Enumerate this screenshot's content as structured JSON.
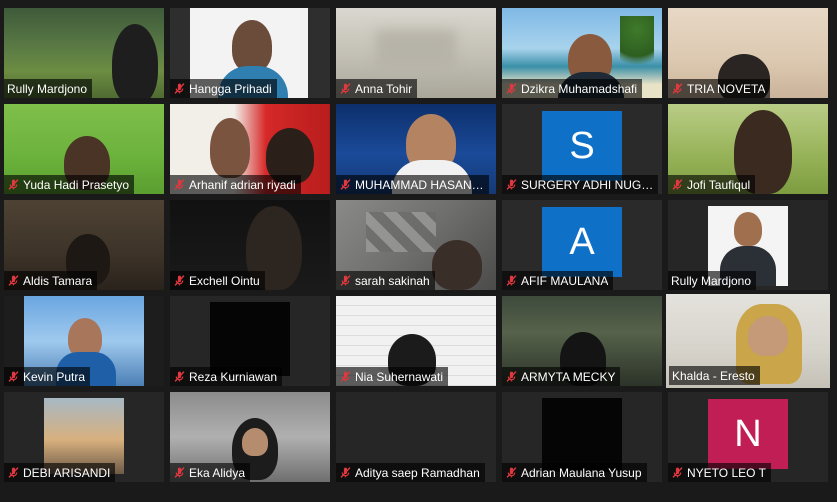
{
  "participants": [
    {
      "name": "Rully Mardjono",
      "muted": false
    },
    {
      "name": "Hangga Prihadi",
      "muted": true
    },
    {
      "name": "Anna Tohir",
      "muted": true
    },
    {
      "name": "Dzikra Muhamadshafi",
      "muted": true
    },
    {
      "name": "TRIA NOVETA",
      "muted": true
    },
    {
      "name": "Yuda Hadi Prasetyo",
      "muted": true
    },
    {
      "name": "Arhanif adrian riyadi",
      "muted": true
    },
    {
      "name": "MUHAMMAD HASAN…",
      "muted": true
    },
    {
      "name": "SURGERY ADHI NUG…",
      "muted": true,
      "avatar_letter": "S"
    },
    {
      "name": "Jofi Taufiqul",
      "muted": true
    },
    {
      "name": "Aldis Tamara",
      "muted": true
    },
    {
      "name": "Exchell Ointu",
      "muted": true
    },
    {
      "name": "sarah sakinah",
      "muted": true
    },
    {
      "name": "AFIF MAULANA",
      "muted": true,
      "avatar_letter": "A"
    },
    {
      "name": "Rully Mardjono",
      "muted": false
    },
    {
      "name": "Kevin Putra",
      "muted": true
    },
    {
      "name": "Reza Kurniawan",
      "muted": true
    },
    {
      "name": "Nia Suhernawati",
      "muted": true
    },
    {
      "name": "ARMYTA MECKY",
      "muted": true
    },
    {
      "name": "Khalda - Eresto",
      "muted": false,
      "active_speaker": true
    },
    {
      "name": "DEBI ARISANDI",
      "muted": true
    },
    {
      "name": "Eka Alidya",
      "muted": true
    },
    {
      "name": "Aditya saep Ramadhan",
      "muted": true
    },
    {
      "name": "Adrian Maulana Yusup",
      "muted": true
    },
    {
      "name": "NYETO LEO T",
      "muted": true,
      "avatar_letter": "N"
    }
  ],
  "colors": {
    "background": "#1a1a1a",
    "active_speaker_border": "#c9d64a",
    "muted_icon": "#e0383e",
    "avatar_blue": "#0e71c7",
    "avatar_pink": "#c21e56"
  },
  "icons": {
    "muted": "mic-muted-icon"
  }
}
